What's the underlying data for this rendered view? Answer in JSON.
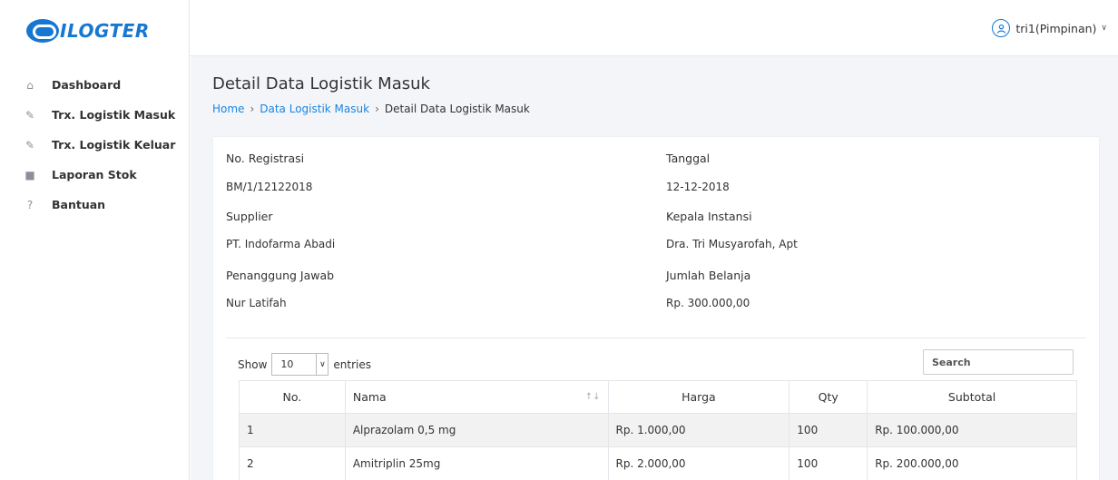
{
  "logo": {
    "text": "ILOGTER"
  },
  "sidebar": {
    "items": [
      {
        "icon": "home-icon",
        "glyph": "⌂",
        "label": "Dashboard"
      },
      {
        "icon": "edit-icon",
        "glyph": "✎",
        "label": "Trx. Logistik Masuk"
      },
      {
        "icon": "edit-icon",
        "glyph": "✎",
        "label": "Trx. Logistik Keluar"
      },
      {
        "icon": "book-icon",
        "glyph": "■",
        "label": "Laporan Stok"
      },
      {
        "icon": "question-icon",
        "glyph": "?",
        "label": "Bantuan"
      }
    ]
  },
  "header": {
    "user_name": "tri1(Pimpinan)"
  },
  "page": {
    "title": "Detail Data Logistik Masuk",
    "breadcrumb": [
      "Home",
      "Data Logistik Masuk",
      "Detail Data Logistik Masuk"
    ]
  },
  "detail": {
    "no_registrasi": {
      "label": "No. Registrasi",
      "value": "BM/1/12122018"
    },
    "tanggal": {
      "label": "Tanggal",
      "value": "12-12-2018"
    },
    "supplier": {
      "label": "Supplier",
      "value": "PT. Indofarma Abadi"
    },
    "kepala_instansi": {
      "label": "Kepala Instansi",
      "value": "Dra. Tri Musyarofah, Apt"
    },
    "penanggung_jawab": {
      "label": "Penanggung Jawab",
      "value": "Nur Latifah"
    },
    "jumlah_belanja": {
      "label": "Jumlah Belanja",
      "value": "Rp. 300.000,00"
    }
  },
  "table": {
    "show_label": "Show",
    "entries_label": "entries",
    "length_value": "10",
    "search_placeholder": "Search",
    "columns": [
      "No.",
      "Nama",
      "Harga",
      "Qty",
      "Subtotal"
    ],
    "rows": [
      {
        "no": "1",
        "nama": "Alprazolam 0,5 mg",
        "harga": "Rp. 1.000,00",
        "qty": "100",
        "subtotal": "Rp. 100.000,00"
      },
      {
        "no": "2",
        "nama": "Amitriplin 25mg",
        "harga": "Rp. 2.000,00",
        "qty": "100",
        "subtotal": "Rp. 200.000,00"
      }
    ]
  },
  "colors": {
    "accent": "#1677d2",
    "link": "#1b84e0",
    "background": "#f3f5f8"
  }
}
